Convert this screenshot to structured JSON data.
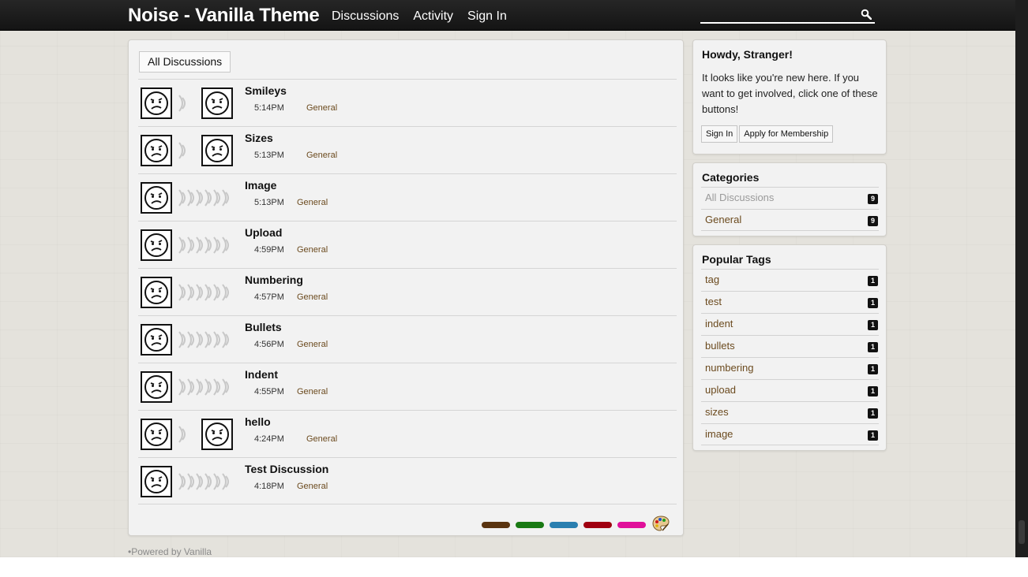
{
  "header": {
    "title": "Noise - Vanilla Theme",
    "nav": [
      "Discussions",
      "Activity",
      "Sign In"
    ],
    "search_value": "",
    "search_icon": "search-icon"
  },
  "main": {
    "tab_label": "All Discussions",
    "discussions": [
      {
        "title": "Smileys",
        "time": "5:14PM",
        "category": "General",
        "two_avatars": true
      },
      {
        "title": "Sizes",
        "time": "5:13PM",
        "category": "General",
        "two_avatars": true
      },
      {
        "title": "Image",
        "time": "5:13PM",
        "category": "General",
        "two_avatars": false
      },
      {
        "title": "Upload",
        "time": "4:59PM",
        "category": "General",
        "two_avatars": false
      },
      {
        "title": "Numbering",
        "time": "4:57PM",
        "category": "General",
        "two_avatars": false
      },
      {
        "title": "Bullets",
        "time": "4:56PM",
        "category": "General",
        "two_avatars": false
      },
      {
        "title": "Indent",
        "time": "4:55PM",
        "category": "General",
        "two_avatars": false
      },
      {
        "title": "hello",
        "time": "4:24PM",
        "category": "General",
        "two_avatars": true
      },
      {
        "title": "Test Discussion",
        "time": "4:18PM",
        "category": "General",
        "two_avatars": false
      }
    ],
    "theme_swatches": [
      "#5a3410",
      "#1a7a14",
      "#2a7fb0",
      "#a00010",
      "#e0109a"
    ],
    "palette_icon": "palette-icon"
  },
  "sidebar": {
    "howdy": {
      "title": "Howdy, Stranger!",
      "text": "It looks like you're new here. If you want to get involved, click one of these buttons!",
      "sign_in_label": "Sign In",
      "apply_label": "Apply for Membership"
    },
    "categories": {
      "title": "Categories",
      "items": [
        {
          "label": "All Discussions",
          "count": "9",
          "muted": true
        },
        {
          "label": "General",
          "count": "9",
          "muted": false
        }
      ]
    },
    "tags": {
      "title": "Popular Tags",
      "items": [
        {
          "label": "tag",
          "count": "1"
        },
        {
          "label": "test",
          "count": "1"
        },
        {
          "label": "indent",
          "count": "1"
        },
        {
          "label": "bullets",
          "count": "1"
        },
        {
          "label": "numbering",
          "count": "1"
        },
        {
          "label": "upload",
          "count": "1"
        },
        {
          "label": "sizes",
          "count": "1"
        },
        {
          "label": "image",
          "count": "1"
        }
      ]
    }
  },
  "footer": {
    "text": "Powered by Vanilla"
  }
}
